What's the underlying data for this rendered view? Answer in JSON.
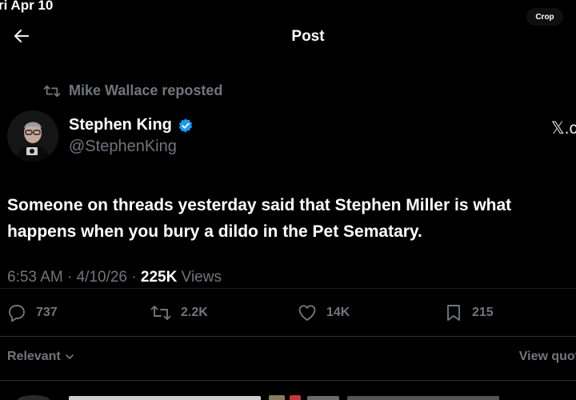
{
  "status_bar": {
    "date": "ri Apr 10"
  },
  "overlay": {
    "crop_label": "Crop"
  },
  "header": {
    "title": "Post"
  },
  "repost": {
    "label": "Mike Wallace reposted"
  },
  "author": {
    "name": "Stephen King",
    "handle": "@StephenKing",
    "verified": true
  },
  "x_link": {
    "text": "𝕏.c"
  },
  "tweet": {
    "line1": "Someone on threads yesterday said that Stephen Miller is what",
    "line2": "happens when you bury a dildo in the Pet Sematary."
  },
  "meta": {
    "time": "6:53 AM",
    "date": "4/10/26",
    "views_count": "225K",
    "views_label": "Views"
  },
  "actions": {
    "replies": "737",
    "reposts": "2.2K",
    "likes": "14K",
    "bookmarks": "215"
  },
  "replies_bar": {
    "sort_label": "Relevant",
    "view_quotes": "View quot"
  },
  "colors": {
    "background": "#000000",
    "text": "#e7e9ea",
    "muted": "#71767b",
    "verified": "#1d9bf0"
  }
}
